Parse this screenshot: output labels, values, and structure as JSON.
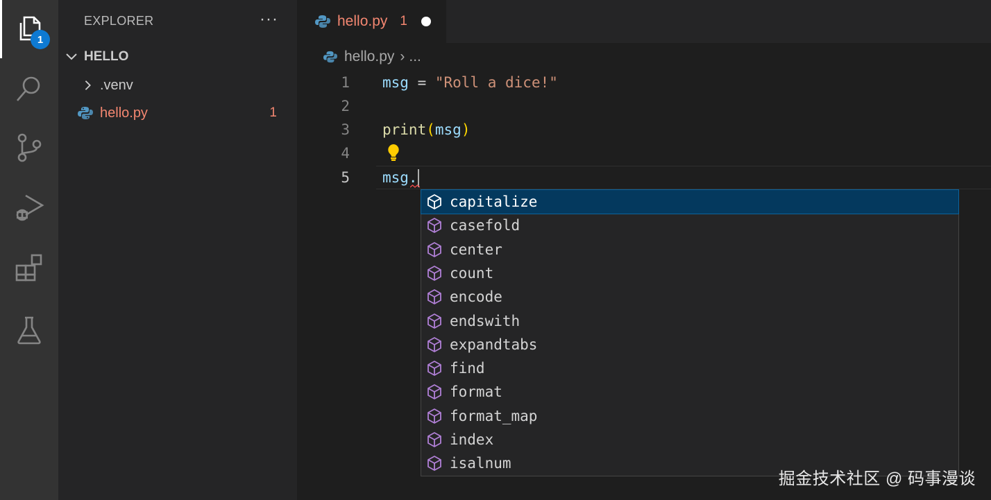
{
  "sidebar": {
    "title": "EXPLORER",
    "more": "···",
    "folder": "HELLO",
    "items": [
      {
        "label": ".venv"
      },
      {
        "label": "hello.py",
        "count": "1"
      }
    ]
  },
  "activity": {
    "explorer_badge": "1"
  },
  "tab": {
    "name": "hello.py",
    "count": "1"
  },
  "breadcrumb": {
    "file": "hello.py",
    "separator": "›",
    "more": "..."
  },
  "editor": {
    "line_numbers": [
      "1",
      "2",
      "3",
      "4",
      "5"
    ],
    "line1": {
      "var": "msg",
      "op": " = ",
      "str": "\"Roll a dice!\""
    },
    "line3": {
      "fn": "print",
      "open": "(",
      "arg": "msg",
      "close": ")"
    },
    "line5": {
      "text": "msg."
    }
  },
  "suggestions": [
    "capitalize",
    "casefold",
    "center",
    "count",
    "encode",
    "endswith",
    "expandtabs",
    "find",
    "format",
    "format_map",
    "index",
    "isalnum"
  ],
  "watermark": "掘金技术社区 @ 码事漫谈",
  "colors": {
    "accent": "#0e7ad3",
    "error": "#f48771",
    "selection": "#04395e",
    "method_icon": "#b180d7"
  }
}
